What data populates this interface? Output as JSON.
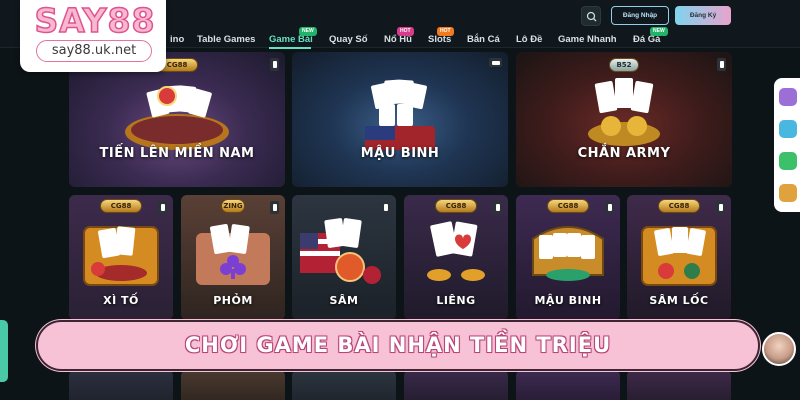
{
  "logo": {
    "text": "SAY88",
    "url": "say88.uk.net"
  },
  "nav": {
    "items": [
      {
        "label": "ino",
        "badge": ""
      },
      {
        "label": "Table Games",
        "badge": ""
      },
      {
        "label": "Game Bài",
        "badge": "NEW",
        "active": true
      },
      {
        "label": "Quay Số",
        "badge": ""
      },
      {
        "label": "Nổ Hũ",
        "badge": "HOT"
      },
      {
        "label": "Slots",
        "badge": "HOT"
      },
      {
        "label": "Bắn Cá",
        "badge": ""
      },
      {
        "label": "Lô Đề",
        "badge": ""
      },
      {
        "label": "Game Nhanh",
        "badge": ""
      },
      {
        "label": "Đá Gà",
        "badge": "NEW"
      }
    ],
    "login_label": "Đăng Nhập",
    "register_label": "Đăng Ký"
  },
  "cards_top": [
    {
      "title": "TIẾN LÊN MIỀN NAM",
      "brand": "CG88"
    },
    {
      "title": "MẬU BINH",
      "brand": ""
    },
    {
      "title": "CHẮN ARMY",
      "brand": "B52"
    }
  ],
  "cards_middle": [
    {
      "title": "XÌ TỐ",
      "brand": "CG88"
    },
    {
      "title": "PHỎM",
      "brand": "ZING"
    },
    {
      "title": "SÂM",
      "brand": ""
    },
    {
      "title": "LIÊNG",
      "brand": "CG88"
    },
    {
      "title": "MẬU BINH",
      "brand": "CG88"
    },
    {
      "title": "SÂM LỐC",
      "brand": "CG88"
    }
  ],
  "banner": {
    "text": "CHƠI GAME BÀI NHẬN TIỀN TRIỆU"
  },
  "colors": {
    "accent": "#66e0c1",
    "banner_bg": "#f7c2d6",
    "logo_pink": "#e0538f"
  }
}
